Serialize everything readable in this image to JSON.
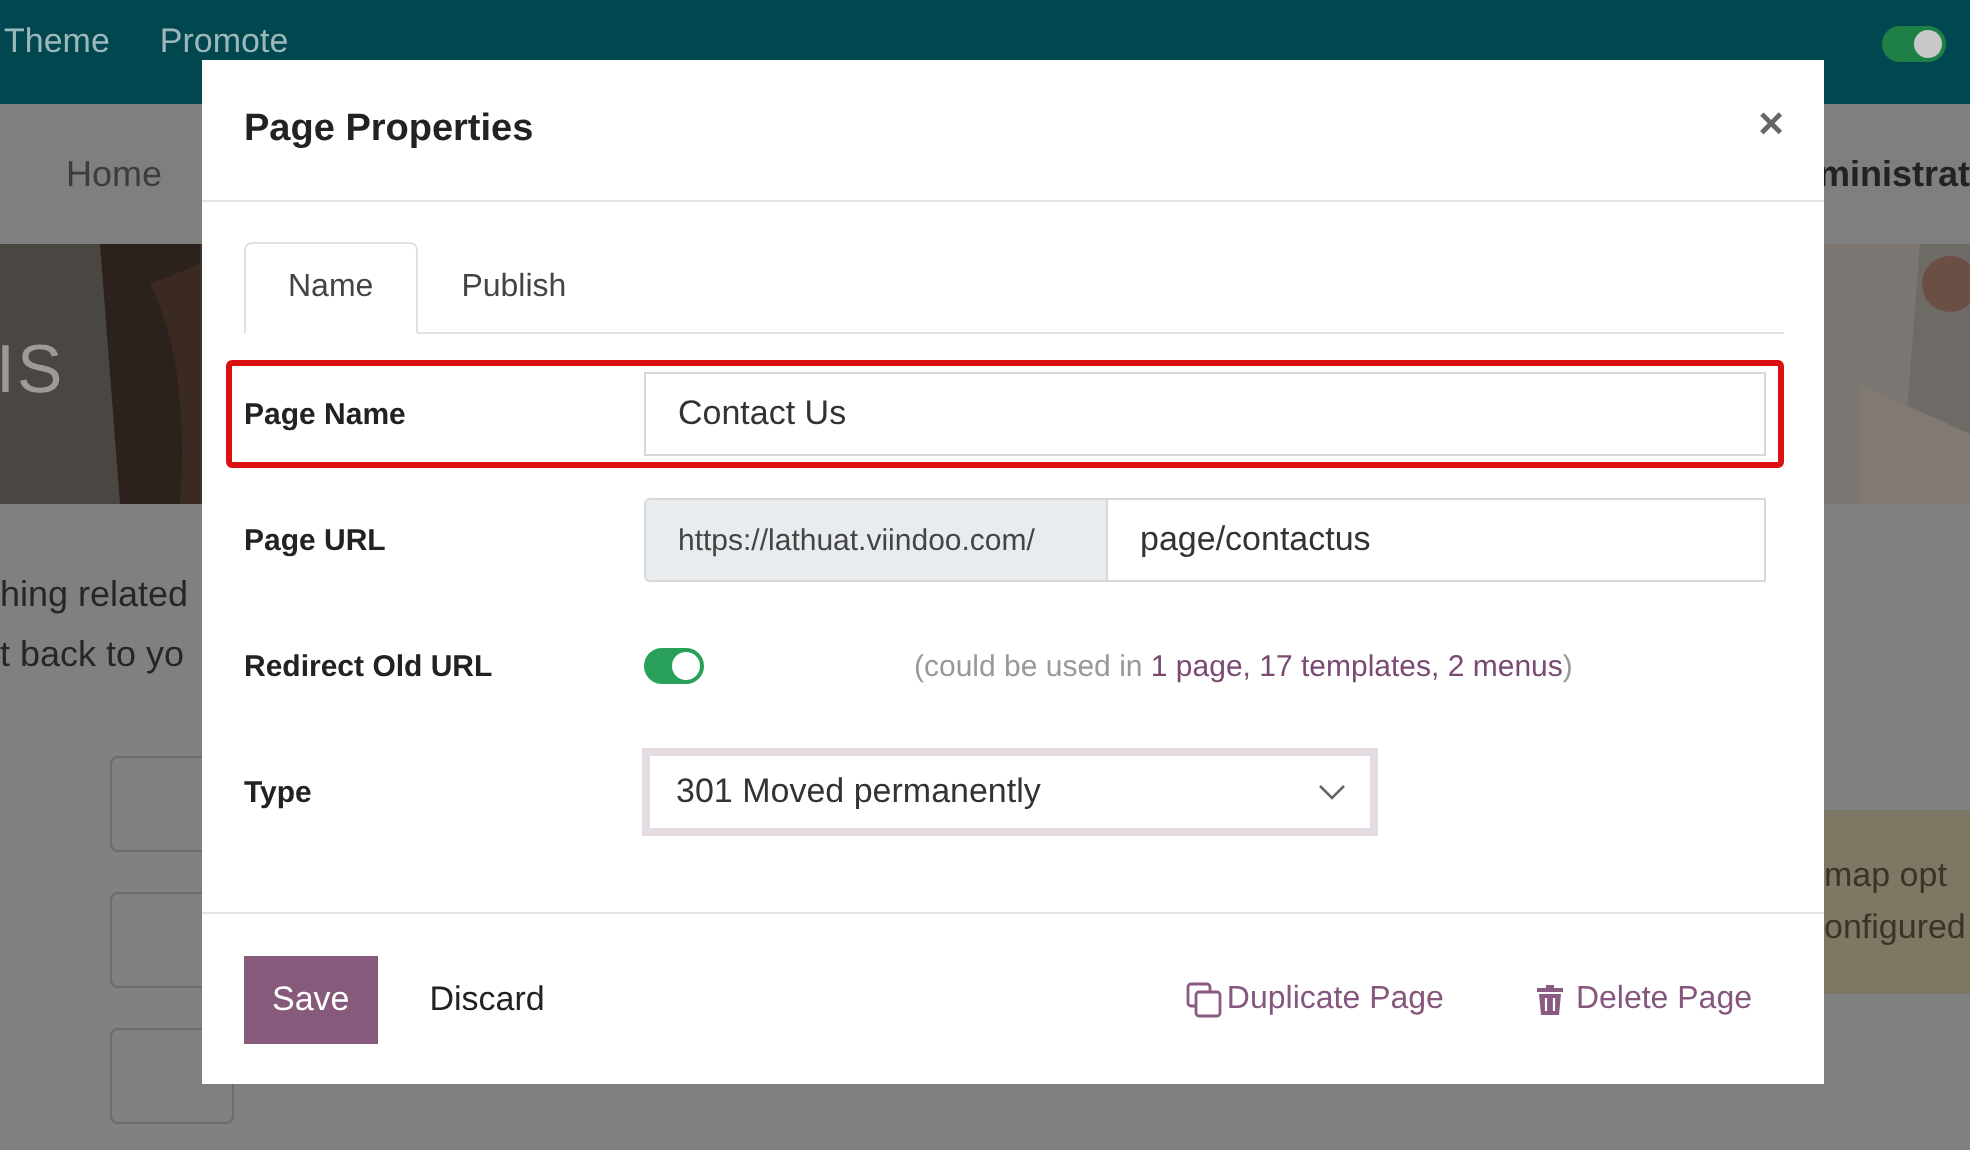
{
  "background": {
    "topbar": {
      "items": [
        "Theme",
        "Promote"
      ],
      "toggle": {
        "on": true
      }
    },
    "nav": {
      "items": [
        "Home"
      ],
      "right_item": "ministrat"
    },
    "hero": {
      "kind": "picture",
      "heading": "IS"
    },
    "text_lines": [
      "hing related",
      "t back to yo"
    ],
    "alert": {
      "lines": [
        "map opt",
        "onfigured"
      ]
    }
  },
  "dialog": {
    "title": "Page Properties",
    "close": "×",
    "tabs": [
      {
        "label": "Name",
        "selected": true
      },
      {
        "label": "Publish",
        "selected": false
      }
    ],
    "fields": [
      {
        "kind": "text",
        "label": "Page Name",
        "value": "Contact Us",
        "highlighted": true
      },
      {
        "kind": "url",
        "label": "Page URL",
        "prefix": "https://lathuat.viindoo.com/",
        "value": "page/contactus"
      },
      {
        "kind": "toggle",
        "label": "Redirect Old URL",
        "on": true,
        "note_before": "(could be used in ",
        "note_link": "1 page, 17 templates, 2 menus",
        "note_after": ")"
      },
      {
        "kind": "select",
        "label": "Type",
        "value": "301 Moved permanently",
        "focused": true
      }
    ],
    "footer": {
      "primary": "Save",
      "secondary": "Discard",
      "links": [
        {
          "kind": "duplicate",
          "label": "Duplicate Page"
        },
        {
          "kind": "delete",
          "label": "Delete Page"
        }
      ]
    }
  }
}
